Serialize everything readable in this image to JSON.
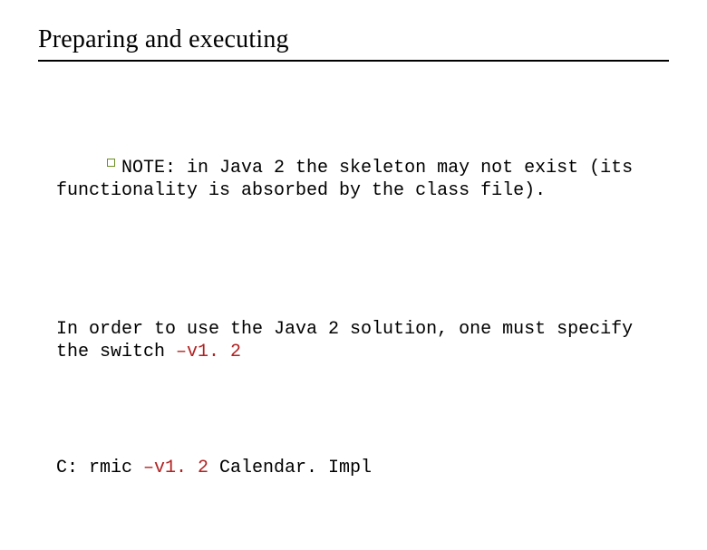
{
  "title": "Preparing and executing",
  "p1_a": "NOTE: in Java 2 the skeleton may not exist (its functionality is absorbed by the class file).",
  "p2_a": "In order to use the Java 2 solution, one must specify the switch ",
  "p2_switch": "–v1. 2",
  "p3_a": "C: rmic ",
  "p3_switch": "–v1. 2",
  "p3_b": " Calendar. Impl"
}
